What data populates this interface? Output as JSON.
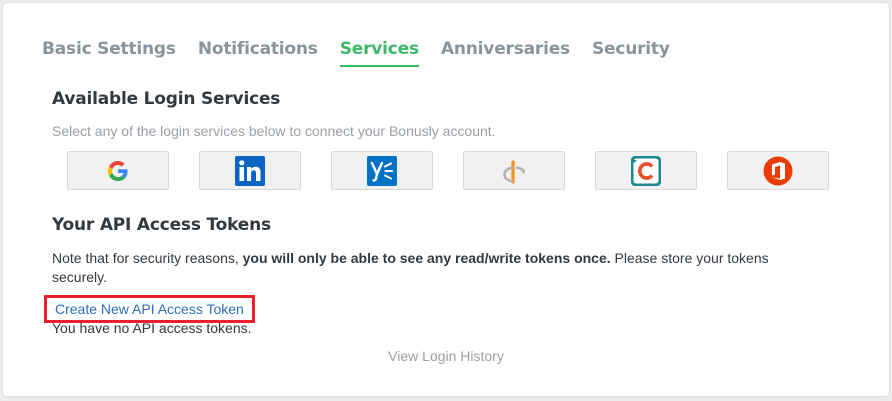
{
  "tabs": [
    {
      "label": "Basic Settings"
    },
    {
      "label": "Notifications"
    },
    {
      "label": "Services"
    },
    {
      "label": "Anniversaries"
    },
    {
      "label": "Security"
    }
  ],
  "active_tab": "Services",
  "login_services": {
    "title": "Available Login Services",
    "subtitle": "Select any of the login services below to connect your Bonusly account.",
    "buttons": [
      {
        "icon": "google-icon"
      },
      {
        "icon": "linkedin-icon"
      },
      {
        "icon": "yammer-icon"
      },
      {
        "icon": "openid-icon"
      },
      {
        "icon": "cyberark-icon"
      },
      {
        "icon": "office-icon"
      }
    ]
  },
  "api": {
    "title": "Your API Access Tokens",
    "note_prefix": "Note that for security reasons, ",
    "note_bold": "you will only be able to see any read/write tokens once.",
    "note_suffix": " Please store your tokens securely.",
    "create_link": "Create New API Access Token",
    "empty_message": "You have no API access tokens."
  },
  "footer": {
    "history_link": "View Login History"
  },
  "colors": {
    "accent": "#3db96a",
    "link": "#2f6fb7",
    "highlight_border": "#e8202a"
  }
}
